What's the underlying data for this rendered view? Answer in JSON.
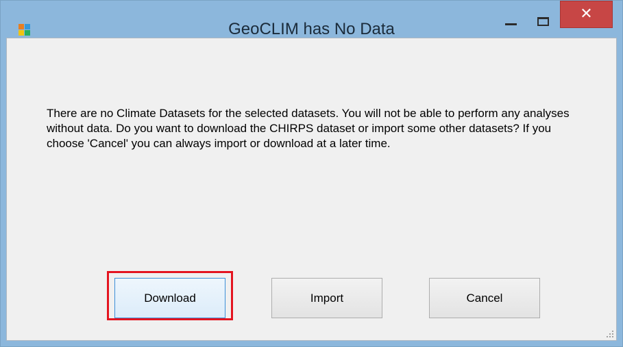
{
  "window": {
    "title": "GeoCLIM has No Data",
    "icon": "app-window-icon",
    "controls": {
      "minimize_icon": "minimize-icon",
      "maximize_icon": "maximize-icon",
      "close_symbol": "✕"
    }
  },
  "dialog": {
    "message": "There are no Climate Datasets for the selected datasets. You will not be able to perform any analyses without data. Do you want to download the CHIRPS dataset or import some other datasets? If you choose 'Cancel' you can always import or download at a later time."
  },
  "buttons": {
    "download": "Download",
    "import": "Import",
    "cancel": "Cancel"
  },
  "colors": {
    "titlebar": "#8cb7dc",
    "close_button": "#c74645",
    "highlight": "#e4141f",
    "client_background": "#f0f0f0"
  }
}
